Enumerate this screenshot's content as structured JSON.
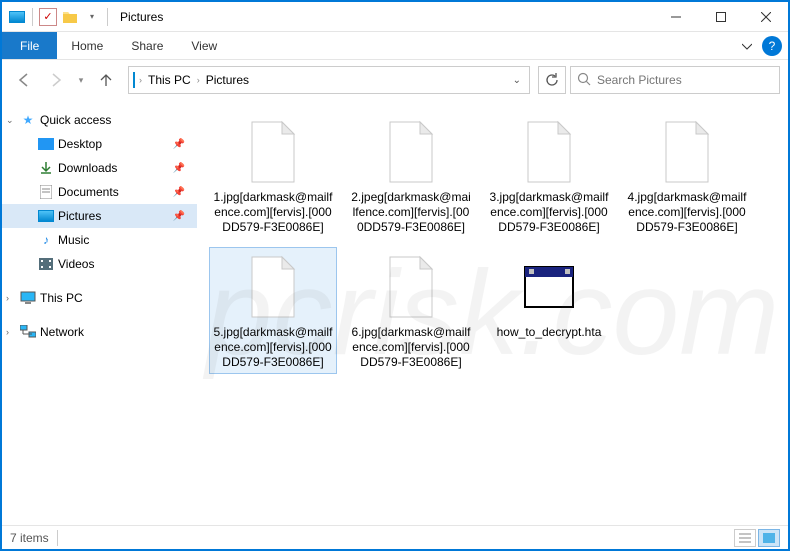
{
  "title_bar": {
    "title": "Pictures"
  },
  "ribbon": {
    "file": "File",
    "home": "Home",
    "share": "Share",
    "view": "View"
  },
  "nav": {
    "back_enabled": false,
    "forward_enabled": false
  },
  "breadcrumb": {
    "root": "This PC",
    "current": "Pictures"
  },
  "search": {
    "placeholder": "Search Pictures"
  },
  "nav_pane": {
    "quick_access": "Quick access",
    "desktop": "Desktop",
    "downloads": "Downloads",
    "documents": "Documents",
    "pictures": "Pictures",
    "music": "Music",
    "videos": "Videos",
    "this_pc": "This PC",
    "network": "Network"
  },
  "files": {
    "items": [
      {
        "name": "1.jpg[darkmask@mailfence.com][fervis].[000DD579-F3E0086E]",
        "type": "generic",
        "selected": false
      },
      {
        "name": "2.jpeg[darkmask@mailfence.com][fervis].[000DD579-F3E0086E]",
        "type": "generic",
        "selected": false
      },
      {
        "name": "3.jpg[darkmask@mailfence.com][fervis].[000DD579-F3E0086E]",
        "type": "generic",
        "selected": false
      },
      {
        "name": "4.jpg[darkmask@mailfence.com][fervis].[000DD579-F3E0086E]",
        "type": "generic",
        "selected": false
      },
      {
        "name": "5.jpg[darkmask@mailfence.com][fervis].[000DD579-F3E0086E]",
        "type": "generic",
        "selected": true
      },
      {
        "name": "6.jpg[darkmask@mailfence.com][fervis].[000DD579-F3E0086E]",
        "type": "generic",
        "selected": false
      },
      {
        "name": "how_to_decrypt.hta",
        "type": "hta",
        "selected": false
      }
    ]
  },
  "status_bar": {
    "count": "7 items"
  },
  "watermark": "pcrisk.com"
}
